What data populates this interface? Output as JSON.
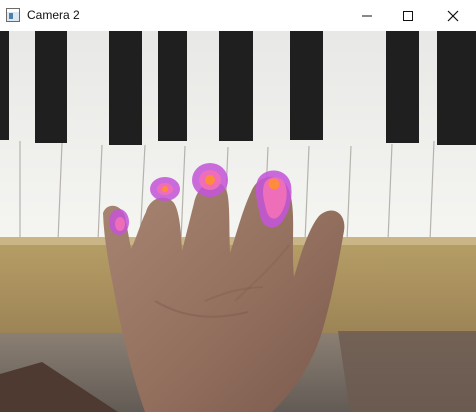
{
  "window": {
    "title": "Camera 2",
    "controls": {
      "minimize": "minimize-icon",
      "maximize": "maximize-icon",
      "close": "close-icon"
    }
  },
  "colors": {
    "titlebar": "#ffffff",
    "heatmap_outer": "#c455d8",
    "heatmap_mid": "#f06fb8",
    "heatmap_core": "#ff8c3a"
  }
}
